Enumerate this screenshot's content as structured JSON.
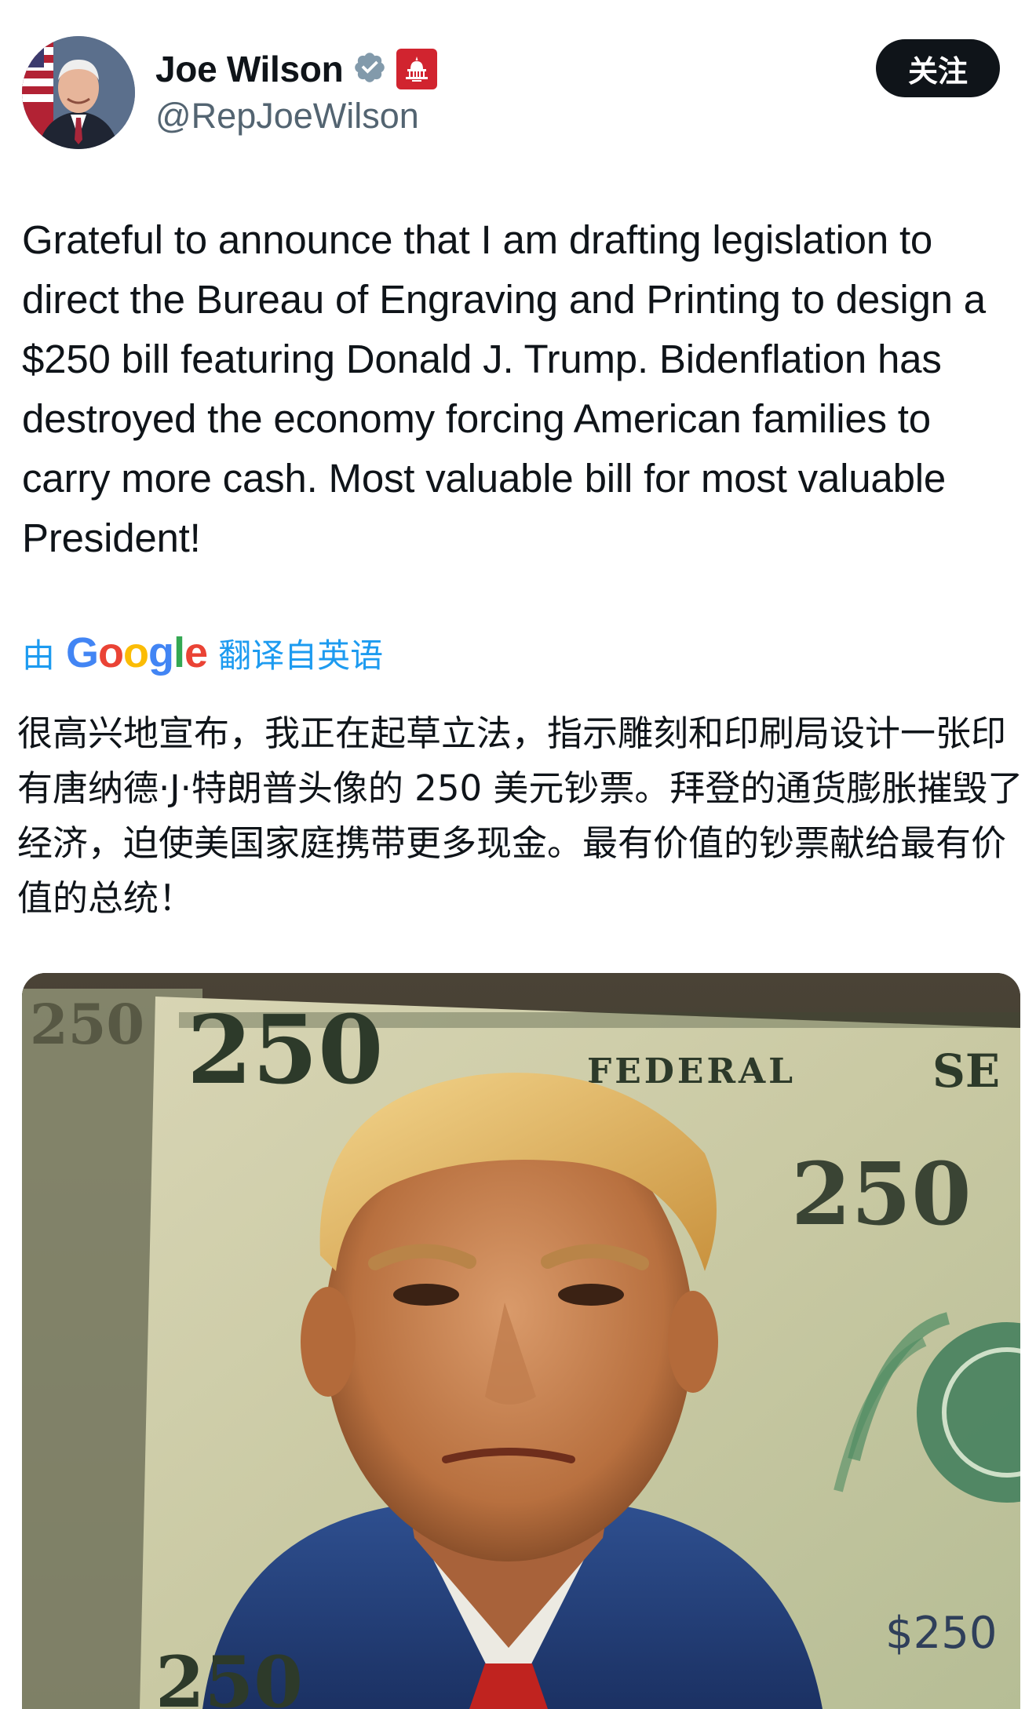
{
  "author": {
    "display_name": "Joe Wilson",
    "handle": "@RepJoeWilson",
    "verified_icon": "verified-badge-icon",
    "affiliation_icon": "capitol-gop-badge-icon"
  },
  "follow_button": {
    "label": "关注"
  },
  "tweet": {
    "text": "Grateful to announce that I am drafting legislation to direct the Bureau of Engraving and Printing to design a $250 bill featuring Donald J. Trump. Bidenflation has destroyed the economy forcing American families to carry more cash. Most valuable bill for most valuable President!"
  },
  "translation": {
    "prefix": "由",
    "provider": "Google",
    "suffix": "翻译自英语",
    "text": "很高兴地宣布，我正在起草立法，指示雕刻和印刷局设计一张印有唐纳德·J·特朗普头像的 250 美元钞票。拜登的通货膨胀摧毁了经济，迫使美国家庭携带更多现金。最有价值的钞票献给最有价值的总统！"
  },
  "media": {
    "bill_numerals": [
      "250",
      "250",
      "250",
      "250",
      "250"
    ],
    "bill_banner": "FEDERAL",
    "bill_side_text": "SE",
    "bill_side_number": "$250"
  },
  "colors": {
    "link_blue": "#1d9bf0",
    "verified_gray": "#829aab",
    "affiliation_red": "#d1242f",
    "follow_bg": "#0f1419",
    "secondary_text": "#536471"
  }
}
